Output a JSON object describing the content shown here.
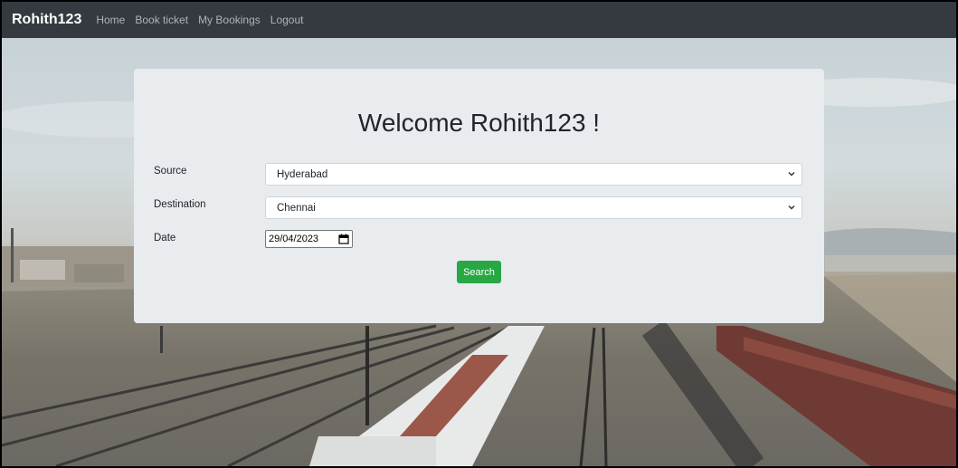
{
  "nav": {
    "brand": "Rohith123",
    "links": [
      "Home",
      "Book ticket",
      "My Bookings",
      "Logout"
    ]
  },
  "form": {
    "title": "Welcome Rohith123 !",
    "source_label": "Source",
    "source_value": "Hyderabad",
    "destination_label": "Destination",
    "destination_value": "Chennai",
    "date_label": "Date",
    "date_value": "29/04/2023",
    "search_label": "Search"
  },
  "colors": {
    "navbar": "#343a40",
    "card": "#e9ecef",
    "button": "#28a745"
  },
  "icons": [
    "chevron-down-icon",
    "calendar-icon"
  ]
}
